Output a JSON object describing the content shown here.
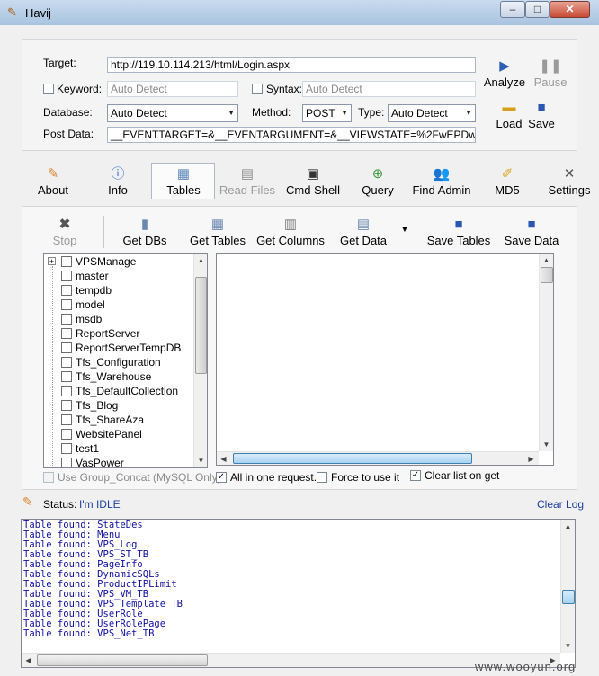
{
  "window": {
    "title": "Havij",
    "min": "–",
    "max": "□",
    "close": "✕",
    "icon": "carrot-icon"
  },
  "form": {
    "target_label": "Target:",
    "target_value": "http://119.10.114.213/html/Login.aspx",
    "keyword_label": "Keyword:",
    "keyword_placeholder": "Auto Detect",
    "syntax_label": "Syntax:",
    "syntax_placeholder": "Auto Detect",
    "database_label": "Database:",
    "database_value": "Auto Detect",
    "method_label": "Method:",
    "method_value": "POST",
    "type_label": "Type:",
    "type_value": "Auto Detect",
    "postdata_label": "Post Data:",
    "postdata_value": "__EVENTTARGET=&__EVENTARGUMENT=&__VIEWSTATE=%2FwEPDw"
  },
  "actions": {
    "analyze": "Analyze",
    "pause": "Pause",
    "load": "Load",
    "save": "Save"
  },
  "tabs": [
    {
      "label": "About",
      "icon": "carrot-icon"
    },
    {
      "label": "Info",
      "icon": "info-icon"
    },
    {
      "label": "Tables",
      "icon": "table-icon"
    },
    {
      "label": "Read Files",
      "icon": "file-icon"
    },
    {
      "label": "Cmd Shell",
      "icon": "terminal-icon"
    },
    {
      "label": "Query",
      "icon": "query-icon"
    },
    {
      "label": "Find Admin",
      "icon": "users-icon"
    },
    {
      "label": "MD5",
      "icon": "brush-icon"
    },
    {
      "label": "Settings",
      "icon": "tools-icon"
    }
  ],
  "toolbar": {
    "stop": "Stop",
    "get_dbs": "Get DBs",
    "get_tables": "Get Tables",
    "get_columns": "Get Columns",
    "get_data": "Get Data",
    "save_tables": "Save Tables",
    "save_data": "Save Data"
  },
  "databases": [
    "VPSManage",
    "master",
    "tempdb",
    "model",
    "msdb",
    "ReportServer",
    "ReportServerTempDB",
    "Tfs_Configuration",
    "Tfs_Warehouse",
    "Tfs_DefaultCollection",
    "Tfs_Blog",
    "Tfs_ShareAza",
    "WebsitePanel",
    "test1",
    "VasPower"
  ],
  "options": {
    "group_concat": "Use Group_Concat (MySQL Only)",
    "all_in_one": "All in one request.",
    "force": "Force to use it",
    "clear_list": "Clear list on get"
  },
  "status": {
    "label": "Status:",
    "value": "I'm IDLE",
    "clear_log": "Clear Log"
  },
  "log": [
    "Table found: StateDes",
    "Table found: Menu",
    "Table found: VPS_Log",
    "Table found: VPS_ST_TB",
    "Table found: PageInfo",
    "Table found: DynamicSQLs",
    "Table found: ProductIPLimit",
    "Table found: VPS_VM_TB",
    "Table found: VPS_Template_TB",
    "Table found: UserRole",
    "Table found: UserRolePage",
    "Table found: VPS_Net_TB"
  ],
  "watermark": "www.wooyun.org"
}
